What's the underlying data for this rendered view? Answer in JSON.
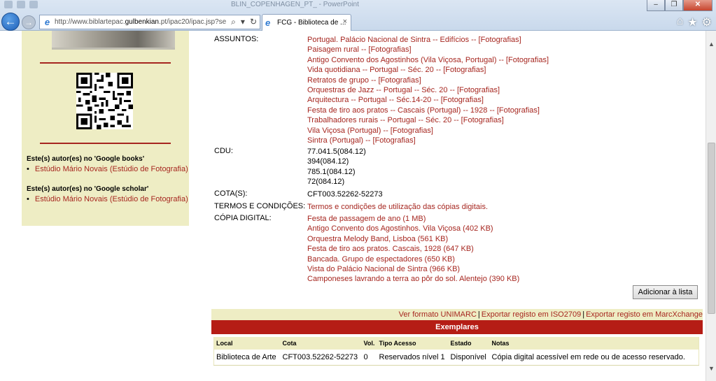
{
  "browser": {
    "window_title": "BLIN_COPENHAGEN_PT_ - PowerPoint",
    "url_prefix": "http://www.biblartepac.",
    "url_domain": "gulbenkian",
    "url_suffix": ".pt/ipac20/ipac.jsp?ses",
    "tab_title": "FCG - Biblioteca de ...",
    "tab_close": "×"
  },
  "sidebar": {
    "google_books_heading": "Este(s) autor(es) no 'Google books'",
    "google_books_link": "Estúdio Mário Novais (Estúdio de Fotografia)",
    "google_scholar_heading": "Este(s) autor(es) no 'Google scholar'",
    "google_scholar_link": "Estúdio Mário Novais (Estúdio de Fotografia)"
  },
  "record": {
    "assuntos_label": "ASSUNTOS:",
    "assuntos": [
      "Portugal. Palácio Nacional de Sintra -- Edifícios -- [Fotografias]",
      "Paisagem rural -- [Fotografias]",
      "Antigo Convento dos Agostinhos (Vila Viçosa, Portugal) -- [Fotografias]",
      "Vida quotidiana -- Portugal -- Séc. 20 -- [Fotografias]",
      "Retratos de grupo -- [Fotografias]",
      "Orquestras de Jazz -- Portugal -- Séc. 20 -- [Fotografias]",
      "Arquitectura -- Portugal -- Séc.14-20 -- [Fotografias]",
      "Festa de tiro aos pratos -- Cascais (Portugal) -- 1928 -- [Fotografias]",
      "Trabalhadores rurais -- Portugal -- Séc. 20 -- [Fotografias]",
      "Vila Viçosa (Portugal) -- [Fotografias]",
      "Sintra (Portugal) -- [Fotografias]"
    ],
    "cdu_label": "CDU:",
    "cdu": [
      "77.041.5(084.12)",
      "394(084.12)",
      "785.1(084.12)",
      "72(084.12)"
    ],
    "cota_label": "COTA(S):",
    "cota": "CFT003.52262-52273",
    "termos_label": "TERMOS E CONDIÇÕES:",
    "termos": "Termos e condições de utilização das cópias digitais.",
    "copia_label": "CÓPIA DIGITAL:",
    "copia": [
      "Festa de passagem de ano (1 MB)",
      "Antigo Convento dos Agostinhos. Vila Viçosa (402 KB)",
      "Orquestra Melody Band, Lisboa (561 KB)",
      "Festa de tiro aos pratos. Cascais, 1928 (647 KB)",
      "Bancada. Grupo de espectadores (650 KB)",
      "Vista do Palácio Nacional de Sintra (966 KB)",
      "Camponeses lavrando a terra ao pôr do sol. Alentejo (390 KB)"
    ],
    "add_to_list": "Adicionar à lista"
  },
  "exports": {
    "unimarc": "Ver formato UNIMARC",
    "iso2709": "Exportar registo em ISO2709",
    "marcxchange": "Exportar registo em MarcXchange",
    "separator": "|"
  },
  "exemplares": {
    "title": "Exemplares",
    "headers": [
      "Local",
      "Cota",
      "Vol.",
      "Tipo Acesso",
      "Estado",
      "Notas"
    ],
    "rows": [
      [
        "Biblioteca de Arte",
        "CFT003.52262-52273",
        "0",
        "Reservados nível 1",
        "Disponível",
        "Cópia digital acessível em rede ou de acesso reservado."
      ]
    ]
  },
  "colors": {
    "accent_red": "#a6261f",
    "header_red": "#b51d15",
    "panel_beige": "#eeedc4"
  }
}
